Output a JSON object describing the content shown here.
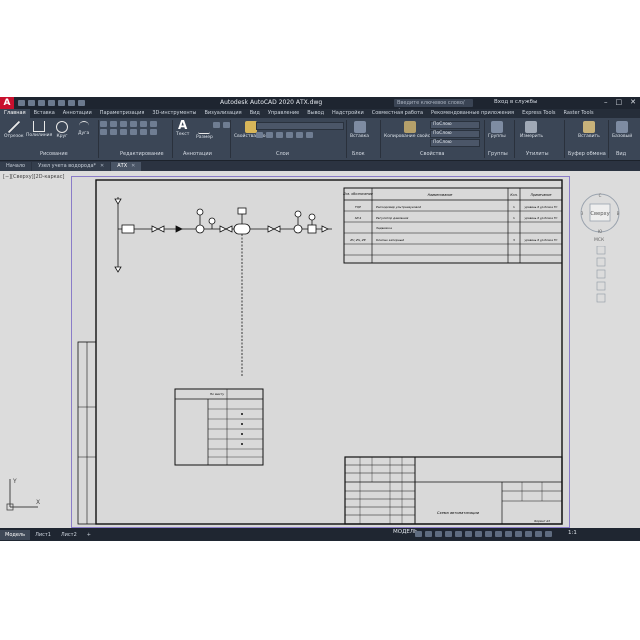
{
  "window": {
    "app_logo": "A",
    "title": "Autodesk AutoCAD 2020   АТХ.dwg",
    "search_placeholder": "Введите ключевое слово/фразу",
    "sign_in": "Вход в службы",
    "controls": [
      "–",
      "□",
      "✕"
    ]
  },
  "ribbon_tabs": [
    "Главная",
    "Вставка",
    "Аннотации",
    "Параметризация",
    "3D-инструменты",
    "Визуализация",
    "Вид",
    "Управление",
    "Вывод",
    "Надстройки",
    "Совместная работа",
    "Рекомендованные приложения",
    "Express Tools",
    "Raster Tools"
  ],
  "ribbon": {
    "draw_tools": [
      "Отрезок",
      "Полилиния",
      "Круг",
      "Дуга"
    ],
    "text_tool": "Текст",
    "dimension_tool": "Размер",
    "layer_props": "Свойства слоя",
    "insert": "Вставка",
    "copy_props": "Копирование свойств",
    "layer_dropdowns": [
      "ПоСлою",
      "ПоСлою",
      "ПоСлою"
    ],
    "groups_tool": "Группы",
    "measure_tool": "Измерить",
    "paste_tool": "Вставить",
    "base_tool": "Базовый",
    "groups": [
      "Рисование",
      "Редактирование",
      "Аннотации",
      "Слои",
      "Блок",
      "Свойства",
      "Группы",
      "Утилиты",
      "Буфер обмена",
      "Вид"
    ]
  },
  "file_tabs": [
    {
      "label": "Начало"
    },
    {
      "label": "Узел учета водорода*"
    },
    {
      "label": "АТХ"
    }
  ],
  "canvas": {
    "view_label": "[−][Сверху][2D-каркас]"
  },
  "viewcube": {
    "face": "Сверху",
    "north": "С",
    "south": "Ю",
    "west": "З",
    "east": "В",
    "wcs": "МСК"
  },
  "drawing": {
    "spec_headers": [
      "Поз. обозначение",
      "Наименование",
      "Кол.",
      "Примечание"
    ],
    "spec_rows": [
      {
        "pos": "FQE",
        "name": "Расходомер ультразвуковой",
        "qty": "1",
        "note": "уровень 6 ур.блока ТС"
      },
      {
        "pos": "SP-4",
        "name": "Регулятор давления",
        "qty": "1",
        "note": "уровень 6 ур.блока ТС"
      },
      {
        "pos": "",
        "name": "Задвижка",
        "qty": "",
        "note": ""
      },
      {
        "pos": "ZV, ZS, ZE",
        "name": "Клапан запорный",
        "qty": "3",
        "note": "уровень 6 ур.блока ТС"
      },
      {
        "pos": "",
        "name": "",
        "qty": "",
        "note": ""
      }
    ],
    "side_table_title": "По месту",
    "title_block_name": "Схема автоматизации",
    "title_block_sheet": "Формат А3"
  },
  "status": {
    "layout_tabs": [
      "Модель",
      "Лист1",
      "Лист2"
    ],
    "add_tab": "+",
    "model_label": "МОДЕЛЬ",
    "scale": "1:1"
  }
}
